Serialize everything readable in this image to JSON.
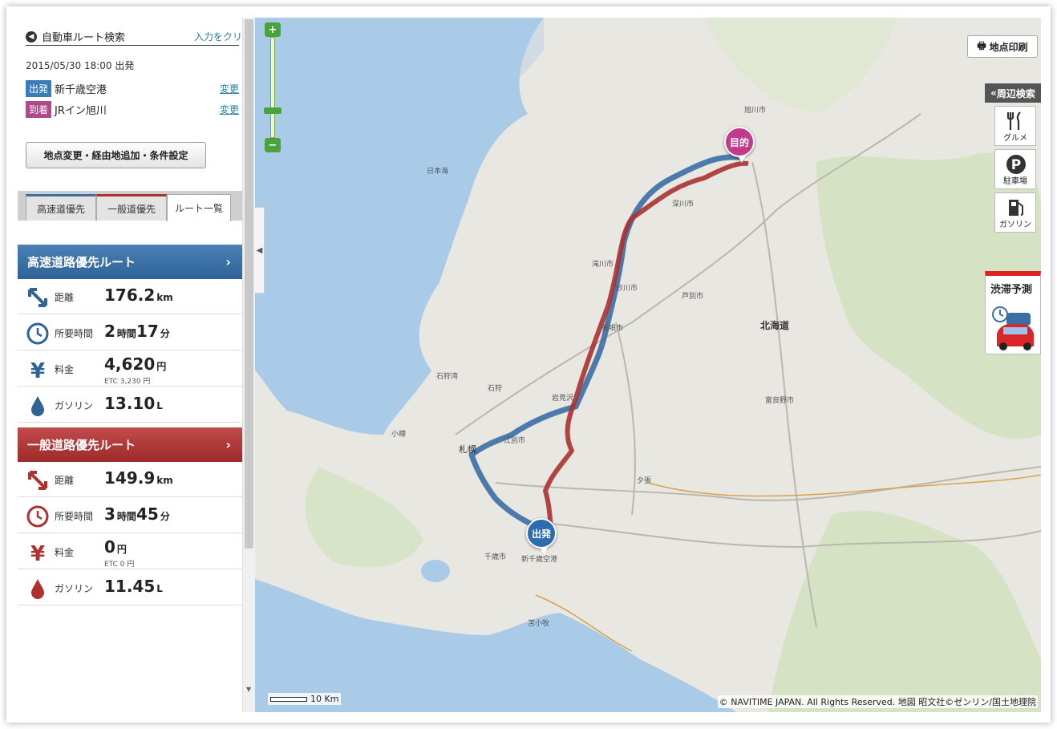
{
  "sidebar": {
    "title": "自動車ルート検索",
    "clear_link": "入力をクリア",
    "datetime": "2015/05/30 18:00 出発",
    "origin": {
      "tag": "出発",
      "name": "新千歳空港",
      "change": "変更",
      "color": "#3a7cb8"
    },
    "destination": {
      "tag": "到着",
      "name": "JRイン旭川",
      "change": "変更",
      "color": "#b04a8e"
    },
    "condition_button": "地点変更・経由地追加・条件設定",
    "tabs": [
      {
        "label": "高速道優先",
        "color": "#3a6ea5"
      },
      {
        "label": "一般道優先",
        "color": "#b03030"
      },
      {
        "label": "ルート一覧"
      }
    ]
  },
  "routes": [
    {
      "title": "高速道路優先ルート",
      "color": "#3a6ea5",
      "distance": {
        "label": "距離",
        "value": "176.2",
        "unit": "km"
      },
      "time": {
        "label": "所要時間",
        "h": "2",
        "h_unit": "時間",
        "m": "17",
        "m_unit": "分"
      },
      "fee": {
        "label": "料金",
        "value": "4,620",
        "unit": "円",
        "etc": "ETC 3,230 円"
      },
      "gas": {
        "label": "ガソリン",
        "value": "13.10",
        "unit": "L"
      }
    },
    {
      "title": "一般道路優先ルート",
      "color": "#b03030",
      "distance": {
        "label": "距離",
        "value": "149.9",
        "unit": "km"
      },
      "time": {
        "label": "所要時間",
        "h": "3",
        "h_unit": "時間",
        "m": "45",
        "m_unit": "分"
      },
      "fee": {
        "label": "料金",
        "value": "0",
        "unit": "円",
        "etc": "ETC 0 円"
      },
      "gas": {
        "label": "ガソリン",
        "value": "11.45",
        "unit": "L"
      }
    }
  ],
  "map": {
    "print_button": "地点印刷",
    "nearby_header": "周辺検索",
    "nearby": [
      "グルメ",
      "駐車場",
      "ガソリン"
    ],
    "jam": "渋滞予測",
    "pin_start": "出発",
    "pin_goal": "目的",
    "region_label": "北海道",
    "scale": "10 Km",
    "copyright": "© NAVITIME JAPAN. All Rights Reserved. 地図 昭文社©ゼンリン/国土地理院",
    "places": [
      "札幌",
      "旭川市",
      "岩見沢",
      "新千歳空港",
      "苫小牧",
      "石狩",
      "小樽",
      "夕張",
      "千歳市",
      "江別市",
      "滝川市",
      "深川市",
      "美唄市",
      "砂川市",
      "芦別市",
      "富良野市",
      "日本海",
      "石狩湾"
    ]
  }
}
